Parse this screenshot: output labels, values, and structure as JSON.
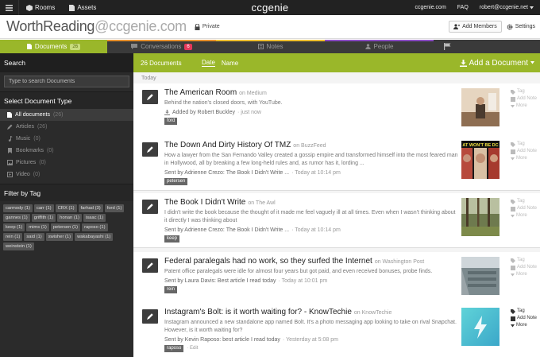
{
  "topbar": {
    "rooms": "Rooms",
    "assets": "Assets",
    "logo": "ccgenie",
    "site": "ccgenie.com",
    "faq": "FAQ",
    "user": "robert@ccgenie.net"
  },
  "header": {
    "brand": "WorthReading",
    "domain": "@ccgenie.com",
    "privacy": "Private",
    "add_members": "Add Members",
    "settings": "Settings"
  },
  "tabs": [
    {
      "label": "Documents",
      "badge": "26",
      "color": "#9ab72a"
    },
    {
      "label": "Conversations",
      "badge": "6",
      "color": "#e8902c"
    },
    {
      "label": "Notes",
      "color": "#f0c030"
    },
    {
      "label": "People",
      "color": "#8a4cc4"
    }
  ],
  "sidebar": {
    "search_title": "Search",
    "search_placeholder": "Type to search Documents",
    "type_title": "Select Document Type",
    "types": [
      {
        "label": "All documents",
        "count": "(26)"
      },
      {
        "label": "Articles",
        "count": "(26)"
      },
      {
        "label": "Music",
        "count": "(0)"
      },
      {
        "label": "Bookmarks",
        "count": "(0)"
      },
      {
        "label": "Pictures",
        "count": "(0)"
      },
      {
        "label": "Video",
        "count": "(0)"
      }
    ],
    "tag_title": "Filter by Tag",
    "tags": [
      "carmody (1)",
      "carr (1)",
      "CRX (1)",
      "farhad (3)",
      "ford (1)",
      "gannes (1)",
      "griffith (1)",
      "honan (1)",
      "isaac (1)",
      "keep (1)",
      "mims (1)",
      "petersen (1)",
      "raposo (1)",
      "rein (1)",
      "said (1)",
      "swisher (1)",
      "wakabayashi (1)",
      "weinstein (1)"
    ]
  },
  "main": {
    "count": "26 Documents",
    "sort_date": "Date",
    "sort_name": "Name",
    "add_doc": "Add a Document",
    "today": "Today",
    "actions": {
      "tag": "Tag",
      "note": "Add Note",
      "more": "More"
    },
    "docs": [
      {
        "title": "The American Room",
        "source": "on Medium",
        "desc": "Behind the nation's closed doors, with YouTube.",
        "by": "Added by Robert Buckley",
        "time": "· just now",
        "tag": "ford"
      },
      {
        "title": "The Down And Dirty History Of TMZ",
        "source": "on BuzzFeed",
        "desc": "How a lawyer from the San Fernando Valley created a gossip empire and transformed himself into the most feared man in Hollywood, all by breaking a few long-held rules and, as rumor has it, lording ...",
        "by": "Sent by Adrienne Crezo: The Book I Didn't Write ...",
        "time": "· Today at 10:14 pm",
        "tag": "petersen"
      },
      {
        "title": "The Book I Didn't Write",
        "source": "on The Awl",
        "desc": "I didn't write the book because the thought of it made me feel vaguely ill at all times. Even when I wasn't thinking about it directly I was thinking about",
        "by": "Sent by Adrienne Crezo: The Book I Didn't Write ...",
        "time": "· Today at 10:14 pm",
        "tag": "keep"
      },
      {
        "title": "Federal paralegals had no work, so they surfed the Internet",
        "source": "on Washington Post",
        "desc": "Patent office paralegals were idle for almost four years but got paid, and even received bonuses, probe finds.",
        "by": "Sent by Laura Davis: Best article I read today",
        "time": "· Today at 10:01 pm",
        "tag": "rein"
      },
      {
        "title": "Instagram's Bolt: is it worth waiting for? - KnowTechie",
        "source": "on KnowTechie",
        "desc": "Instagram announced a new standalone app named Bolt. It's a photo messaging app looking to take on rival Snapchat. However, is it worth waiting for?",
        "by": "Sent by Kevin Raposo: best article I read today",
        "time": "· Yesterday at 5:08 pm",
        "tag": "raposo",
        "edit": "· Edit"
      }
    ],
    "thumb2_caption": "AT WON'T BE DC"
  }
}
